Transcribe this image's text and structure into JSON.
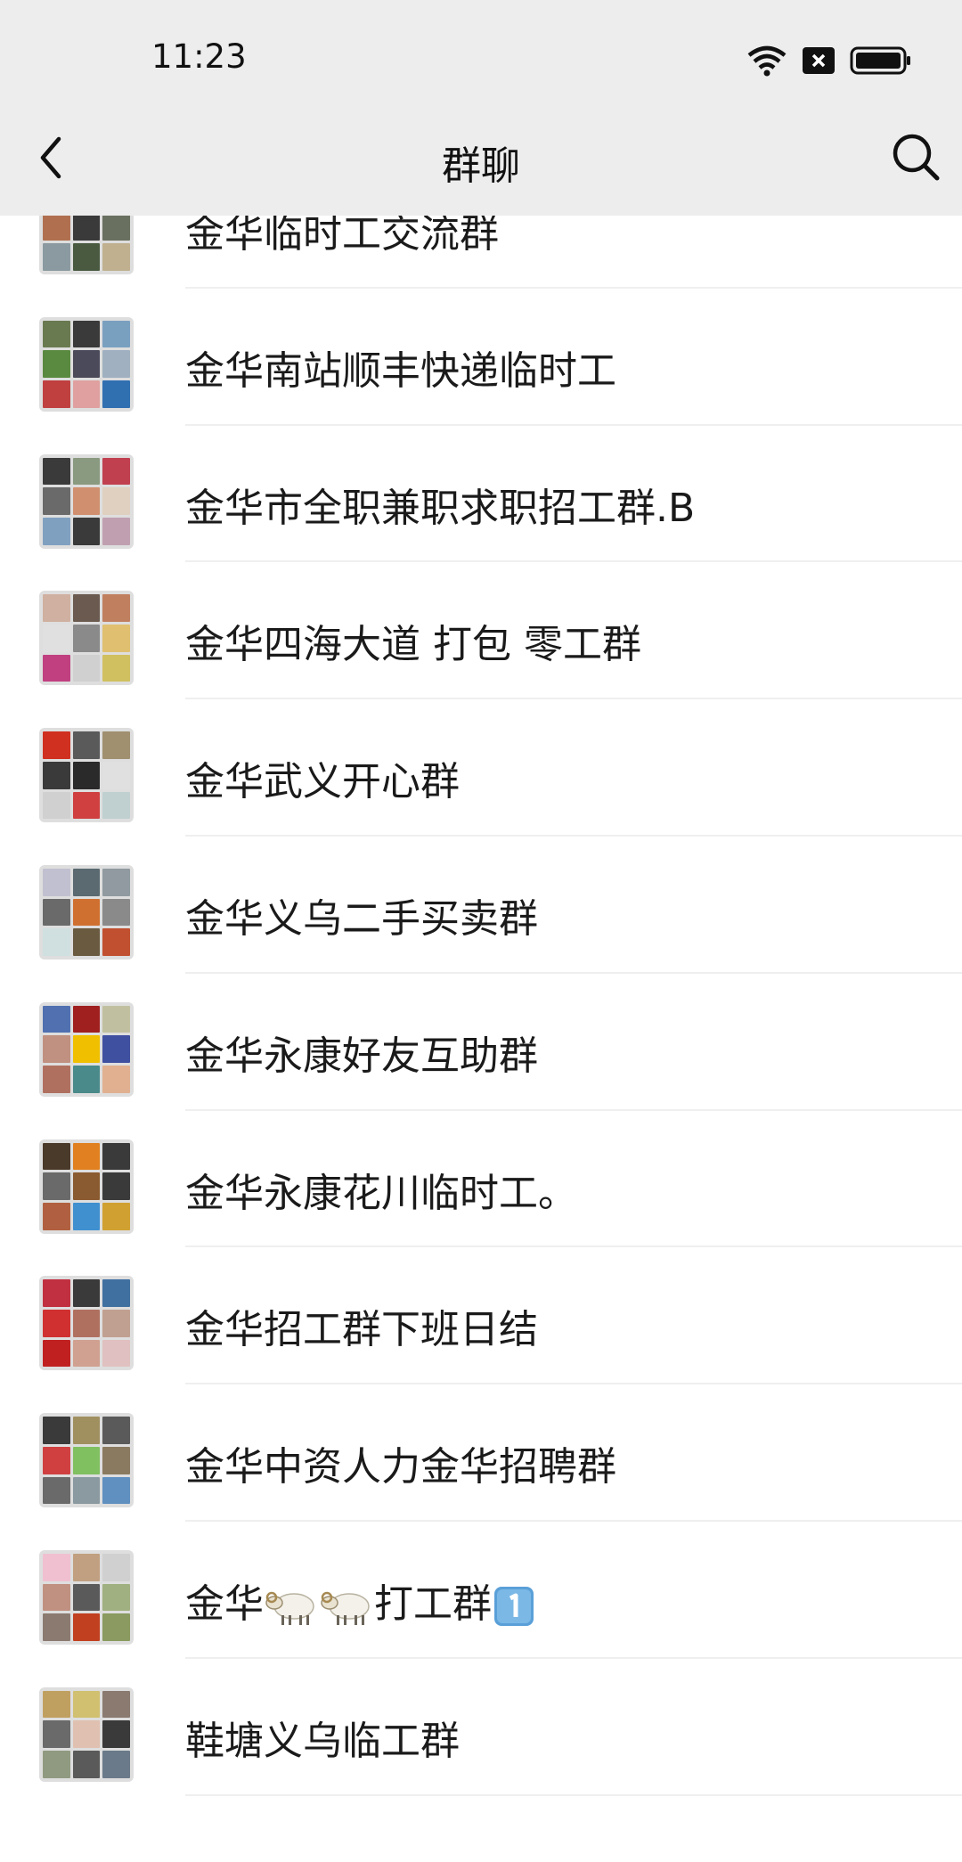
{
  "status_bar": {
    "time": "11:23"
  },
  "header": {
    "title": "群聊"
  },
  "groups": [
    {
      "name": "金华临时工交流群",
      "colors": [
        "#c8a080",
        "#8a8a8a",
        "#5a6a7a",
        "#b07050",
        "#3a3a3a",
        "#6a7060",
        "#8a9aa0",
        "#4a5a40",
        "#c0b090"
      ]
    },
    {
      "name": "金华南站顺丰快递临时工",
      "colors": [
        "#6a7a50",
        "#3a3a3a",
        "#7aa0c0",
        "#5a8a40",
        "#4a4a5a",
        "#a0b0c0",
        "#c04040",
        "#e0a0a0",
        "#3070b0"
      ]
    },
    {
      "name": "金华市全职兼职求职招工群.B",
      "colors": [
        "#3a3a3a",
        "#8a9a80",
        "#c04050",
        "#6a6a6a",
        "#d09070",
        "#e0d0c0",
        "#80a0c0",
        "#3a3a3a",
        "#c0a0b0"
      ]
    },
    {
      "name": "金华四海大道 打包 零工群",
      "colors": [
        "#d0b0a0",
        "#6a5a50",
        "#c08060",
        "#e0e0e0",
        "#8a8a8a",
        "#e0c070",
        "#c04080",
        "#d0d0d0",
        "#d0c060"
      ]
    },
    {
      "name": "金华武义开心群",
      "colors": [
        "#d03020",
        "#5a5a5a",
        "#a09070",
        "#3a3a3a",
        "#2a2a2a",
        "#e0e0e0",
        "#d0d0d0",
        "#d04040",
        "#c0d0d0"
      ]
    },
    {
      "name": "金华义乌二手买卖群",
      "colors": [
        "#c0c0d0",
        "#5a6a70",
        "#909aa0",
        "#6a6a6a",
        "#d07030",
        "#8a8a8a",
        "#d0e0e0",
        "#6a5a40",
        "#c05030"
      ]
    },
    {
      "name": "金华永康好友互助群",
      "colors": [
        "#5070b0",
        "#a02020",
        "#c0c0a0",
        "#c09080",
        "#f0c000",
        "#4050a0",
        "#b07060",
        "#4a8a8a",
        "#e0b090"
      ]
    },
    {
      "name": "金华永康花川临时工。",
      "colors": [
        "#4a3a2a",
        "#e08020",
        "#3a3a3a",
        "#6a6a6a",
        "#8a5a30",
        "#3a3a3a",
        "#b06040",
        "#4090d0",
        "#d0a030"
      ]
    },
    {
      "name": "金华招工群下班日结",
      "colors": [
        "#c03040",
        "#3a3a3a",
        "#4070a0",
        "#d03030",
        "#b07060",
        "#c0a090",
        "#c02020",
        "#d0a090",
        "#e0c0c0"
      ]
    },
    {
      "name": "金华中资人力金华招聘群",
      "colors": [
        "#3a3a3a",
        "#a09060",
        "#5a5a5a",
        "#d04040",
        "#80c060",
        "#8a7a60",
        "#6a6a6a",
        "#8a9aa0",
        "#6090c0"
      ]
    },
    {
      "name": "金华",
      "suffix": "打工群",
      "colors": [
        "#f0c0d0",
        "#c0a080",
        "#d0d0d0",
        "#c09080",
        "#5a5a5a",
        "#a0b080",
        "#8a7a70",
        "#c04020",
        "#8a9a60"
      ]
    },
    {
      "name": "鞋塘义乌临工群",
      "colors": [
        "#c0a060",
        "#d0c070",
        "#8a7a70",
        "#6a6a6a",
        "#e0c0b0",
        "#3a3a3a",
        "#909a80",
        "#5a5a5a",
        "#6a7a8a"
      ]
    }
  ]
}
